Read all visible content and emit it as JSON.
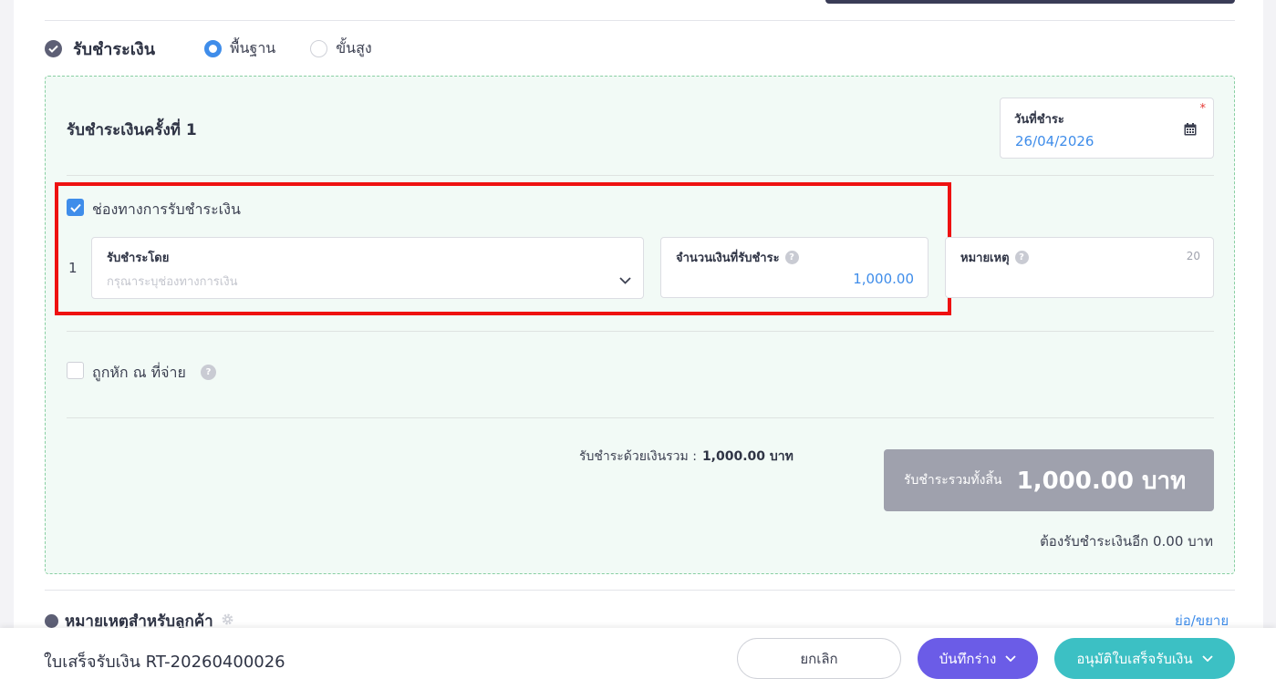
{
  "section": {
    "title": "รับชำระเงิน",
    "mode_options": [
      {
        "label": "พื้นฐาน",
        "selected": true
      },
      {
        "label": "ขั้นสูง",
        "selected": false
      }
    ]
  },
  "payment_round": {
    "title": "รับชำระเงินครั้งที่ 1",
    "date_label": "วันที่ชำระ",
    "date_required_mark": "*",
    "date_value": "26/04/2026"
  },
  "channel": {
    "checkbox_label": "ช่องทางการรับชำระเงิน",
    "checked": true,
    "row_index": "1",
    "method_label": "รับชำระโดย",
    "method_placeholder": "กรุณาระบุช่องทางการเงิน",
    "amount_label": "จำนวนเงินที่รับชำระ",
    "amount_value": "1,000.00",
    "note_label": "หมายเหตุ",
    "note_max_length": "20",
    "help_glyph": "?"
  },
  "withholding": {
    "label": "ถูกหัก ณ ที่จ่าย",
    "checked": false
  },
  "totals": {
    "paid_label": "รับชำระด้วยเงินรวม :",
    "paid_value": "1,000.00 บาท",
    "grand_label": "รับชำระรวมทั้งสิ้น",
    "grand_value": "1,000.00 บาท",
    "remaining_text": "ต้องรับชำระเงินอีก 0.00 บาท"
  },
  "customer_notes": {
    "title": "หมายเหตุสำหรับลูกค้า",
    "toggle_label": "ย่อ/ขยาย"
  },
  "footer": {
    "document_title": "ใบเสร็จรับเงิน RT-20260400026",
    "cancel_label": "ยกเลิก",
    "draft_label": "บันทึกร่าง",
    "approve_label": "อนุมัติใบเสร็จรับเงิน"
  },
  "colors": {
    "accent_blue": "#3f8dea",
    "draft_purple": "#6b5ce7",
    "approve_teal": "#3cc0c4",
    "highlight_red": "#ee1111",
    "panel_green_bg": "#f2faf6"
  },
  "icons": [
    "check-circle-icon",
    "radio-icon",
    "calendar-icon",
    "checkbox-icon",
    "chevron-down-icon",
    "help-icon",
    "gear-icon"
  ]
}
